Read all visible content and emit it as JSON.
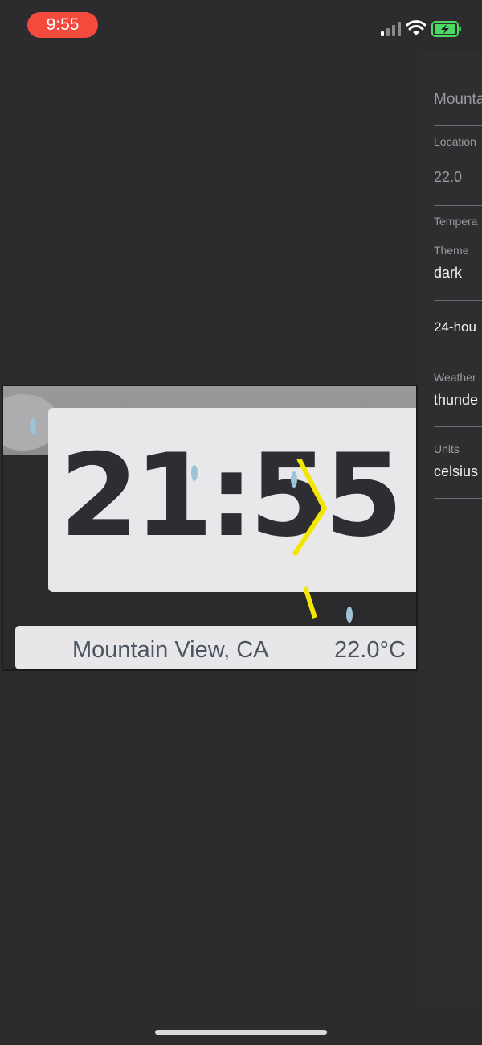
{
  "status_bar": {
    "time": "9:55",
    "pill_color": "#f24a3d",
    "icons": [
      "signal-icon",
      "wifi-icon",
      "battery-charging-icon"
    ]
  },
  "widget": {
    "clock": "21:55",
    "location": "Mountain View, CA",
    "temperature": "22.0°C",
    "weather_effects": [
      "rain-drops",
      "lightning-bolt",
      "clouds"
    ]
  },
  "settings": {
    "location_value": "Mounta",
    "location_label": "Location",
    "temperature_value": "22.0",
    "temperature_label": "Tempera",
    "theme_label": "Theme",
    "theme_value": "dark",
    "time_format_value": "24-hou",
    "weather_label": "Weather",
    "weather_value": "thunde",
    "units_label": "Units",
    "units_value": "celsius"
  }
}
